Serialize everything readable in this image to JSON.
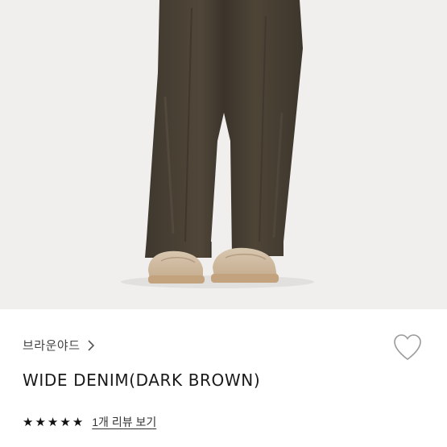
{
  "product": {
    "brand": "브라운야드",
    "title": "WIDE DENIM(DARK BROWN)",
    "rating": 5,
    "review_link": "1개 리뷰 보기"
  },
  "icons": {
    "brand_chevron": "chevron-right-icon",
    "wishlist": "heart-outline-icon",
    "star": "star-icon"
  },
  "colors": {
    "pants": "#4a4236",
    "shoe": "#cdb79c",
    "photo_bg": "#f0efee"
  }
}
